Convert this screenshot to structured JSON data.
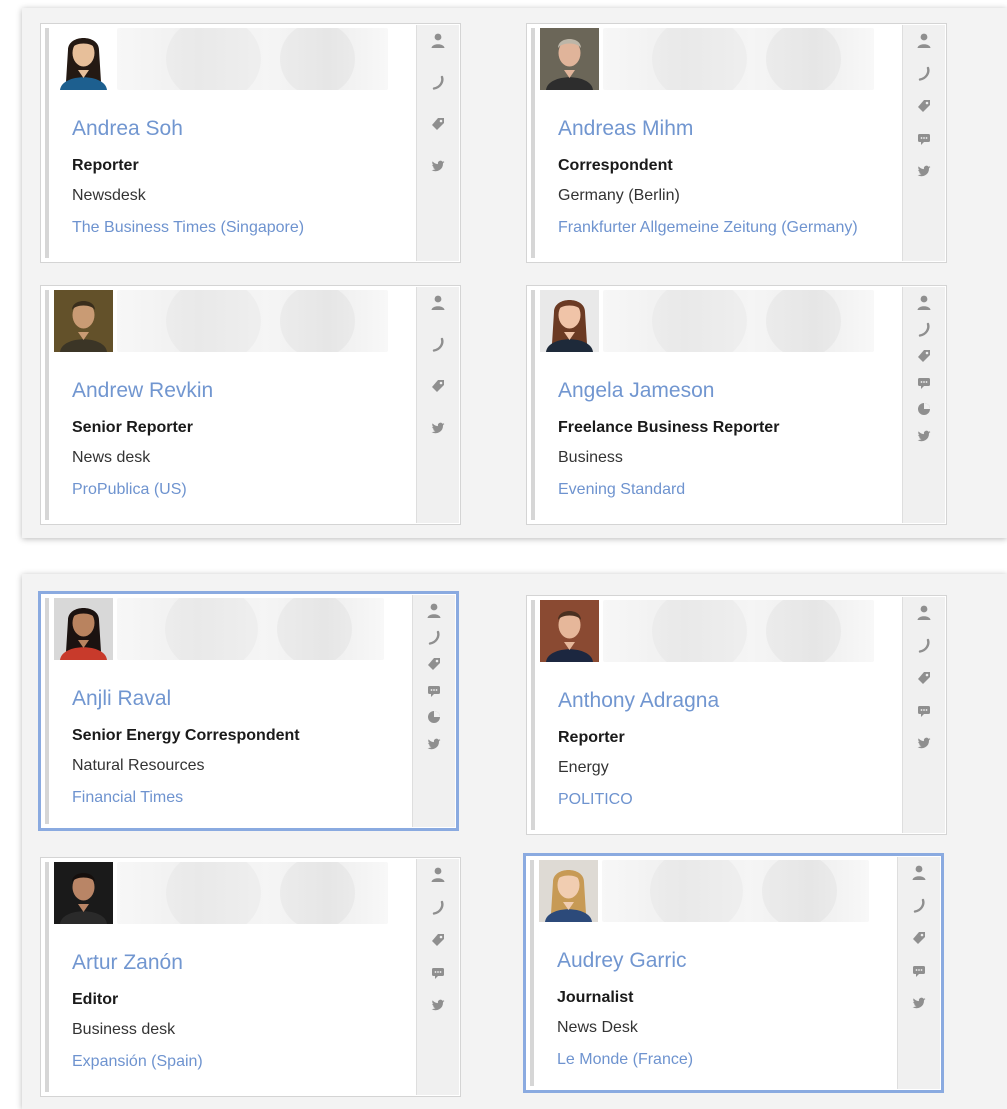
{
  "colors": {
    "name_link": "#7196d0",
    "outlet_link": "#6e93cf",
    "selected_border": "#8aaae0",
    "icon_gray": "#8f8f8f"
  },
  "panels": [
    {
      "cards": [
        {
          "name": "Andrea Soh",
          "role": "Reporter",
          "department": "Newsdesk",
          "outlet": "The Business Times (Singapore)",
          "selected": false,
          "actions": [
            "person-icon",
            "phone-icon",
            "tag-icon",
            "twitter-icon"
          ]
        },
        {
          "name": "Andreas Mihm",
          "role": "Correspondent",
          "department": "Germany (Berlin)",
          "outlet": "Frankfurter Allgemeine Zeitung (Germany)",
          "selected": false,
          "actions": [
            "person-icon",
            "phone-icon",
            "tag-icon",
            "chat-icon",
            "twitter-icon"
          ]
        },
        {
          "name": "Andrew Revkin",
          "role": "Senior Reporter",
          "department": "News desk",
          "outlet": "ProPublica (US)",
          "selected": false,
          "actions": [
            "person-icon",
            "phone-icon",
            "tag-icon",
            "twitter-icon"
          ]
        },
        {
          "name": "Angela Jameson",
          "role": "Freelance Business Reporter",
          "department": "Business",
          "outlet": "Evening Standard",
          "selected": false,
          "actions": [
            "person-icon",
            "phone-icon",
            "tag-icon",
            "chat-icon",
            "pie-chart-icon",
            "twitter-icon"
          ]
        }
      ]
    },
    {
      "cards": [
        {
          "name": "Anjli Raval",
          "role": "Senior Energy Correspondent",
          "department": "Natural Resources",
          "outlet": "Financial Times",
          "selected": true,
          "actions": [
            "person-icon",
            "phone-icon",
            "tag-icon",
            "chat-icon",
            "pie-chart-icon",
            "twitter-icon"
          ]
        },
        {
          "name": "Anthony Adragna",
          "role": "Reporter",
          "department": "Energy",
          "outlet": "POLITICO",
          "selected": false,
          "actions": [
            "person-icon",
            "phone-icon",
            "tag-icon",
            "chat-icon",
            "twitter-icon"
          ]
        },
        {
          "name": "Artur Zanón",
          "role": "Editor",
          "department": "Business desk",
          "outlet": "Expansión (Spain)",
          "selected": false,
          "actions": [
            "person-icon",
            "phone-icon",
            "tag-icon",
            "chat-icon",
            "twitter-icon"
          ]
        },
        {
          "name": "Audrey Garric",
          "role": "Journalist",
          "department": "News Desk",
          "outlet": "Le Monde (France)",
          "selected": true,
          "actions": [
            "person-icon",
            "phone-icon",
            "tag-icon",
            "chat-icon",
            "twitter-icon"
          ]
        }
      ]
    }
  ]
}
